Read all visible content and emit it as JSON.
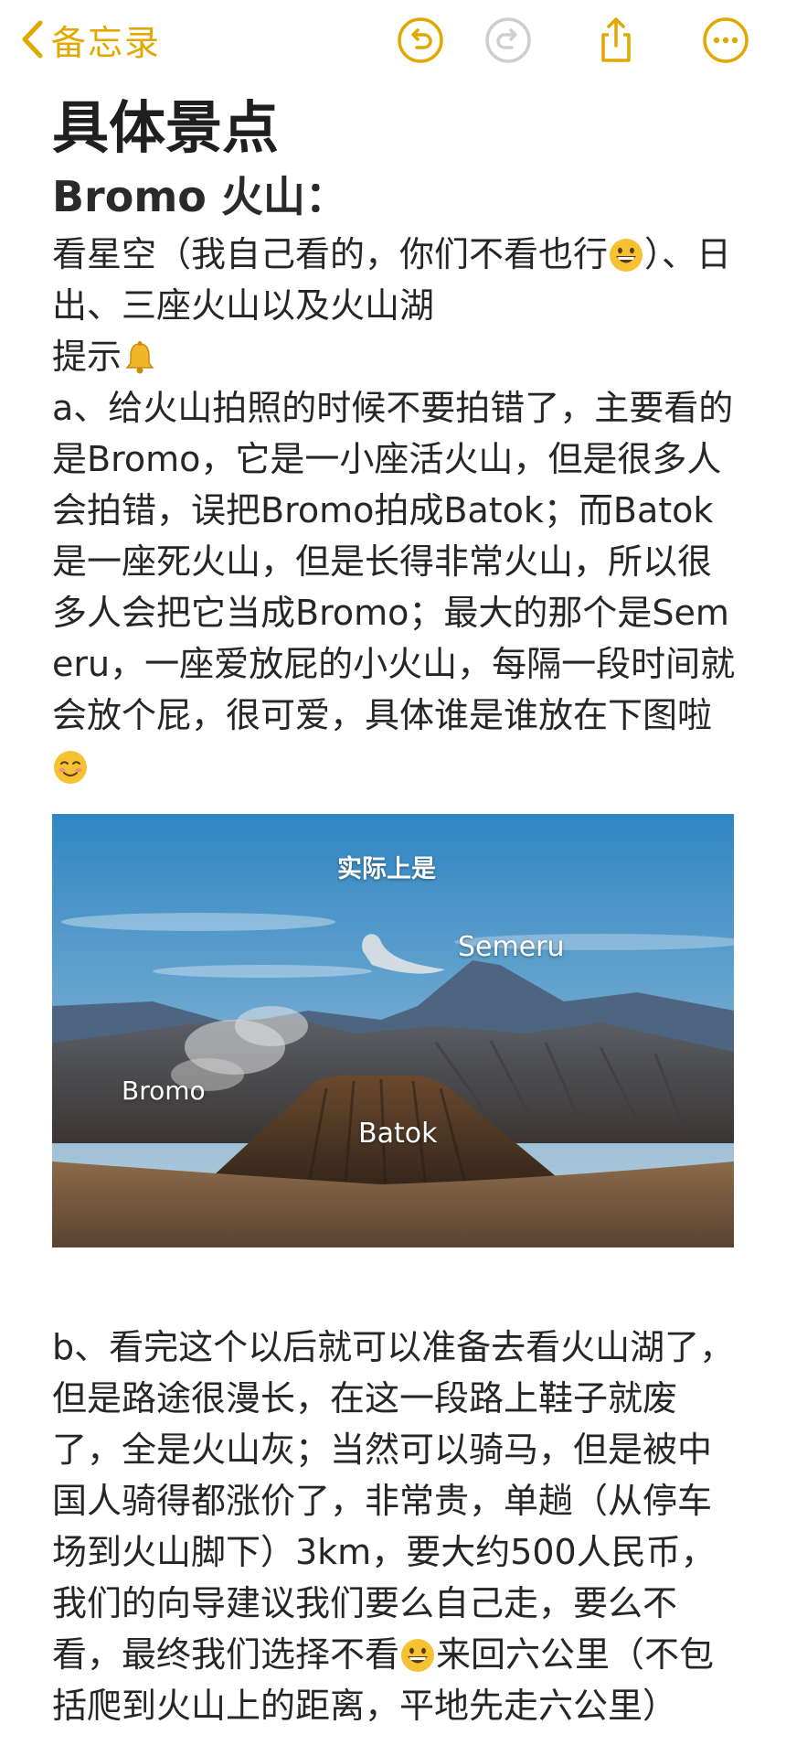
{
  "nav": {
    "back_label": "备忘录",
    "accent_color": "#E0A800",
    "icons": [
      "chevron-left-icon",
      "undo-icon",
      "redo-icon",
      "share-icon",
      "more-icon"
    ]
  },
  "note": {
    "title": "具体景点",
    "subtitle": "Bromo 火山：",
    "p1_before_emoji": "看星空（我自己看的，你们不看也行",
    "p1_after_emoji": "）、日出、三座火山以及火山湖",
    "tip_label": "提示",
    "p2_part_a": "a、给火山拍照的时候不要拍错了，主要看的是Bromo，它是一小座活火山，但是很多人会拍错，误把Bromo拍成Batok；而Batok是一座死火山，但是长得非常火山，所以很多人会把它当成Bromo；最大的那个是Semeru，一座爱放屁的小火山，每隔一段时间就会放个屁，很可爱，具体谁是谁放在下图啦",
    "photo_labels": {
      "caption": "实际上是",
      "semeru": "Semeru",
      "bromo": "Bromo",
      "batok": "Batok"
    },
    "p3_part_b_before_emoji": "b、看完这个以后就可以准备去看火山湖了，但是路途很漫长，在这一段路上鞋子就废了，全是火山灰；当然可以骑马，但是被中国人骑得都涨价了，非常贵，单趟（从停车场到火山脚下）3km，要大约500人民币，我们的向导建议我们要么自己走，要么不看，最终我们选择不看",
    "p3_part_b_after_emoji": "来回六公里（不包括爬到火山上的距离，平地先走六公里）"
  }
}
